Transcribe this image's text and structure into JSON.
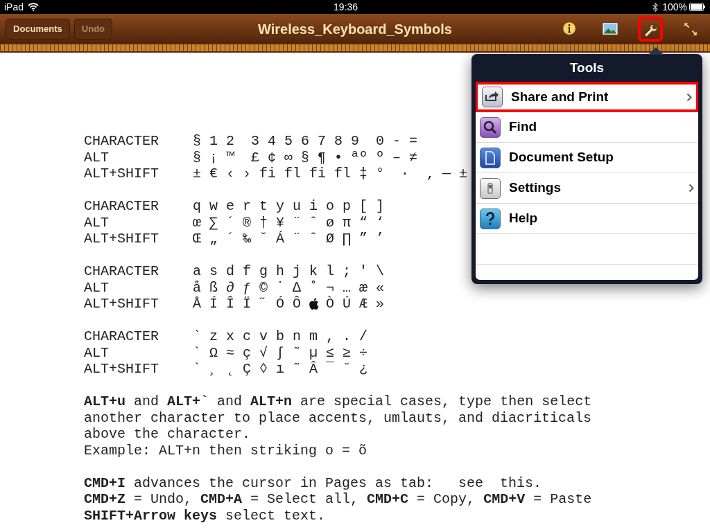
{
  "status_bar": {
    "device": "iPad",
    "time": "19:36",
    "battery": "100%"
  },
  "toolbar": {
    "title": "Wireless_Keyboard_Symbols",
    "buttons": [
      {
        "label": "Documents",
        "disabled": false
      },
      {
        "label": "Undo",
        "disabled": true
      }
    ],
    "tools": [
      {
        "kind": "info",
        "highlighted": false
      },
      {
        "kind": "media",
        "highlighted": false
      },
      {
        "kind": "tools",
        "highlighted": true
      },
      {
        "kind": "fullscreen",
        "highlighted": false
      }
    ]
  },
  "document": {
    "groups": [
      {
        "rows": [
          {
            "label": "CHARACTER",
            "segments": [
              "§ 1 2  3 4 5 6 7 8 9  0 - ="
            ]
          },
          {
            "label": "ALT",
            "segments": [
              "§ ¡ ™  £ ¢ ∞ § ¶ • ªº º – ≠"
            ]
          },
          {
            "label": "ALT+SHIFT",
            "segments": [
              "± € ‹ › fi fl fi fl ‡ °  ·  ‚ — ±"
            ]
          }
        ]
      },
      {
        "rows": [
          {
            "label": "CHARACTER",
            "segments": [
              "q w e r t y u i o p [ ]"
            ]
          },
          {
            "label": "ALT",
            "segments": [
              "œ ∑ ´ ® † ¥ ¨ ˆ ø π “ ‘"
            ]
          },
          {
            "label": "ALT+SHIFT",
            "segments": [
              "Œ „ ´ ‰ ˇ Á ¨ ˆ Ø ∏ ” ’"
            ]
          }
        ]
      },
      {
        "rows": [
          {
            "label": "CHARACTER",
            "segments": [
              "a s d f g h j k l ; ' \\"
            ]
          },
          {
            "label": "ALT",
            "segments": [
              "å ß ∂ ƒ © ˙ ∆ ˚ ¬ … æ «"
            ]
          },
          {
            "label": "ALT+SHIFT",
            "segments": [
              "Å Í Î Ï ˝ Ó Ô",
              {
                "kind": "apple-logo"
              },
              "Ò Ú Æ »"
            ]
          }
        ]
      },
      {
        "rows": [
          {
            "label": "CHARACTER",
            "segments": [
              "` z x c v b n m , . /"
            ]
          },
          {
            "label": "ALT",
            "segments": [
              "` Ω ≈ ç √ ∫ ˜ µ ≤ ≥ ÷"
            ]
          },
          {
            "label": "ALT+SHIFT",
            "segments": [
              "` ¸ ˛ Ç ◊ ı ˜ Â ¯ ˘ ¿"
            ]
          }
        ]
      }
    ],
    "paragraphs": [
      [
        "**ALT+u** and **ALT+`** and **ALT+n** are special cases, type then select another character to place accents, umlauts, and diacriticals above the character.",
        "Example: ALT+n then striking o = õ"
      ],
      [
        "**CMD+I** advances the cursor in Pages as tab:   see  this.",
        "**CMD+Z** = Undo, **CMD+A** = Select all, **CMD+C** = Copy, **CMD+V** = Paste",
        "**SHIFT+Arrow keys** select text."
      ]
    ]
  },
  "popover": {
    "title": "Tools",
    "items": [
      {
        "label": "Share and Print",
        "kind": "share",
        "chevron": true,
        "highlighted": true
      },
      {
        "label": "Find",
        "kind": "find",
        "chevron": false,
        "highlighted": false
      },
      {
        "label": "Document Setup",
        "kind": "setup",
        "chevron": false,
        "highlighted": false
      },
      {
        "label": "Settings",
        "kind": "settings",
        "chevron": true,
        "highlighted": false
      },
      {
        "label": "Help",
        "kind": "help",
        "chevron": false,
        "highlighted": false
      }
    ]
  }
}
